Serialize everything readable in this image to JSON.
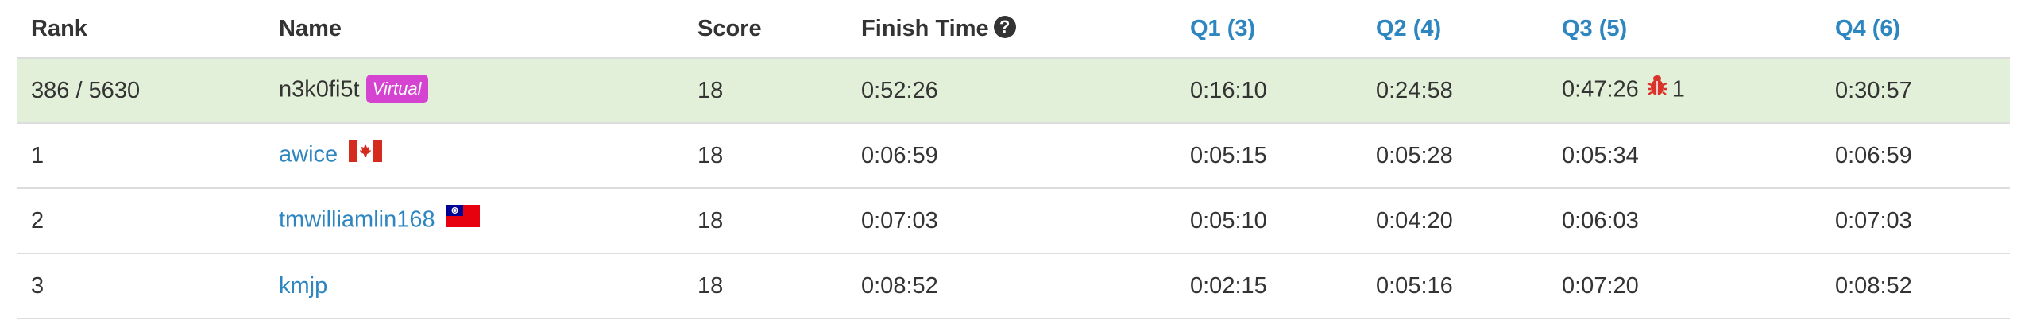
{
  "headers": {
    "rank": "Rank",
    "name": "Name",
    "score": "Score",
    "finish_time": "Finish Time",
    "q1": "Q1 (3)",
    "q2": "Q2 (4)",
    "q3": "Q3 (5)",
    "q4": "Q4 (6)"
  },
  "current_user": {
    "rank": "386 / 5630",
    "name": "n3k0fi5t",
    "badge": "Virtual",
    "score": "18",
    "finish_time": "0:52:26",
    "q1": "0:16:10",
    "q2": "0:24:58",
    "q3": "0:47:26",
    "q3_wrong": "1",
    "q4": "0:30:57"
  },
  "rows": [
    {
      "rank": "1",
      "name": "awice",
      "flag": "canada-flag-icon",
      "score": "18",
      "finish_time": "0:06:59",
      "q1": "0:05:15",
      "q2": "0:05:28",
      "q3": "0:05:34",
      "q4": "0:06:59"
    },
    {
      "rank": "2",
      "name": "tmwilliamlin168",
      "flag": "taiwan-flag-icon",
      "score": "18",
      "finish_time": "0:07:03",
      "q1": "0:05:10",
      "q2": "0:04:20",
      "q3": "0:06:03",
      "q4": "0:07:03"
    },
    {
      "rank": "3",
      "name": "kmjp",
      "score": "18",
      "finish_time": "0:08:52",
      "q1": "0:02:15",
      "q2": "0:05:16",
      "q3": "0:07:20",
      "q4": "0:08:52"
    }
  ],
  "colors": {
    "link": "#2e86c1",
    "highlight_row": "#e3f0d9",
    "virtual_badge": "#d543d1",
    "bug": "#d9342b"
  }
}
